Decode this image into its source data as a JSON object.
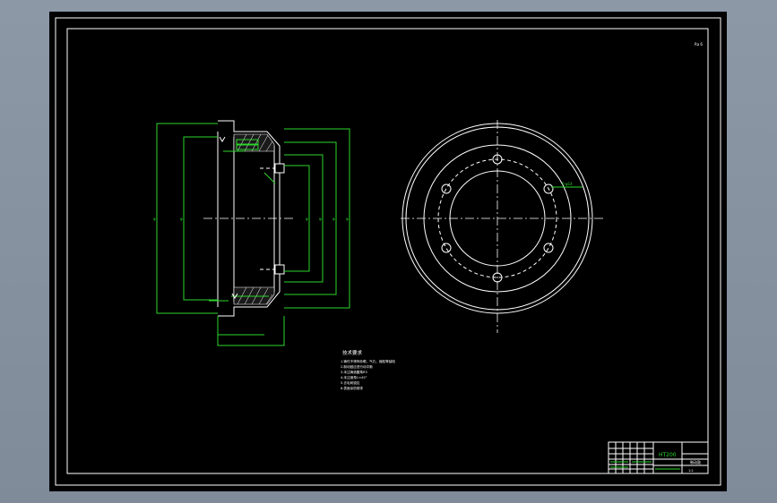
{
  "drawing": {
    "corner_mark": "Ra 6",
    "notes_title": "技术要求",
    "notes": [
      "1.铸件不得有砂眼、气孔、缩松等缺陷",
      "2.制动鼓应进行动平衡",
      "3.未注铸造圆角R3",
      "4.未注倒角1×45°",
      "5.去毛刺锐边",
      "6.表面涂防锈漆"
    ],
    "material": "HT200",
    "part_name": "制动鼓",
    "scale": "1:2"
  },
  "colors": {
    "outline": "#ffffff",
    "dimension": "#2bd62b",
    "sheet": "#000000",
    "viewport": "#8b97a5"
  }
}
